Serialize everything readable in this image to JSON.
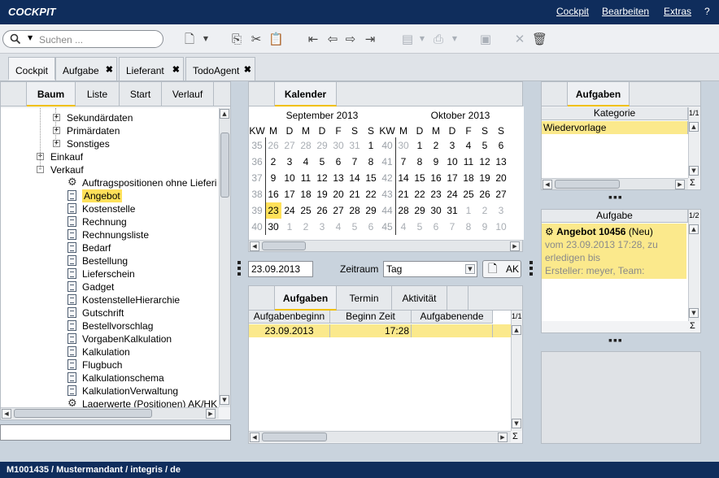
{
  "titlebar": {
    "app": "COCKPIT",
    "menu": [
      "Cockpit",
      "Bearbeiten",
      "Extras",
      "?"
    ]
  },
  "toolbar": {
    "search_placeholder": "Suchen ..."
  },
  "tabs": [
    {
      "label": "Cockpit",
      "closable": false
    },
    {
      "label": "Aufgabe",
      "closable": true
    },
    {
      "label": "Lieferant",
      "closable": true
    },
    {
      "label": "TodoAgent",
      "closable": true
    }
  ],
  "left": {
    "subtabs": [
      "Baum",
      "Liste",
      "Start",
      "Verlauf"
    ],
    "tree": [
      {
        "level": 2,
        "toggle": "+",
        "icon": "",
        "label": "Sekundärdaten"
      },
      {
        "level": 2,
        "toggle": "+",
        "icon": "",
        "label": "Primärdaten"
      },
      {
        "level": 2,
        "toggle": "+",
        "icon": "",
        "label": "Sonstiges"
      },
      {
        "level": 1,
        "toggle": "+",
        "icon": "",
        "label": "Einkauf"
      },
      {
        "level": 1,
        "toggle": "-",
        "icon": "",
        "label": "Verkauf"
      },
      {
        "level": 3,
        "toggle": "",
        "icon": "gear",
        "label": "Auftragspositionen ohne Lieferi"
      },
      {
        "level": 3,
        "toggle": "",
        "icon": "doc",
        "label": "Angebot",
        "selected": true
      },
      {
        "level": 3,
        "toggle": "",
        "icon": "doc",
        "label": "Kostenstelle"
      },
      {
        "level": 3,
        "toggle": "",
        "icon": "doc",
        "label": "Rechnung"
      },
      {
        "level": 3,
        "toggle": "",
        "icon": "doc",
        "label": "Rechnungsliste"
      },
      {
        "level": 3,
        "toggle": "",
        "icon": "doc",
        "label": "Bedarf"
      },
      {
        "level": 3,
        "toggle": "",
        "icon": "doc",
        "label": "Bestellung"
      },
      {
        "level": 3,
        "toggle": "",
        "icon": "doc",
        "label": "Lieferschein"
      },
      {
        "level": 3,
        "toggle": "",
        "icon": "doc",
        "label": "Gadget"
      },
      {
        "level": 3,
        "toggle": "",
        "icon": "doc",
        "label": "KostenstelleHierarchie"
      },
      {
        "level": 3,
        "toggle": "",
        "icon": "doc",
        "label": "Gutschrift"
      },
      {
        "level": 3,
        "toggle": "",
        "icon": "doc",
        "label": "Bestellvorschlag"
      },
      {
        "level": 3,
        "toggle": "",
        "icon": "doc",
        "label": "VorgabenKalkulation"
      },
      {
        "level": 3,
        "toggle": "",
        "icon": "doc",
        "label": "Kalkulation"
      },
      {
        "level": 3,
        "toggle": "",
        "icon": "doc",
        "label": "Flugbuch"
      },
      {
        "level": 3,
        "toggle": "",
        "icon": "doc",
        "label": "Kalkulationschema"
      },
      {
        "level": 3,
        "toggle": "",
        "icon": "doc",
        "label": "KalkulationVerwaltung"
      },
      {
        "level": 3,
        "toggle": "",
        "icon": "gear",
        "label": "Lagerwerte (Positionen) AK/HK"
      }
    ]
  },
  "calendar": {
    "tab": "Kalender",
    "months": [
      "September 2013",
      "Oktober 2013"
    ],
    "headers": [
      "KW",
      "M",
      "D",
      "M",
      "D",
      "F",
      "S",
      "S"
    ],
    "sep": [
      [
        "35",
        "26",
        "27",
        "28",
        "29",
        "30",
        "31",
        "1"
      ],
      [
        "36",
        "2",
        "3",
        "4",
        "5",
        "6",
        "7",
        "8"
      ],
      [
        "37",
        "9",
        "10",
        "11",
        "12",
        "13",
        "14",
        "15"
      ],
      [
        "38",
        "16",
        "17",
        "18",
        "19",
        "20",
        "21",
        "22"
      ],
      [
        "39",
        "23",
        "24",
        "25",
        "26",
        "27",
        "28",
        "29"
      ],
      [
        "40",
        "30",
        "1",
        "2",
        "3",
        "4",
        "5",
        "6"
      ]
    ],
    "oct": [
      [
        "40",
        "30",
        "1",
        "2",
        "3",
        "4",
        "5",
        "6"
      ],
      [
        "41",
        "7",
        "8",
        "9",
        "10",
        "11",
        "12",
        "13"
      ],
      [
        "42",
        "14",
        "15",
        "16",
        "17",
        "18",
        "19",
        "20"
      ],
      [
        "43",
        "21",
        "22",
        "23",
        "24",
        "25",
        "26",
        "27"
      ],
      [
        "44",
        "28",
        "29",
        "30",
        "31",
        "1",
        "2",
        "3"
      ],
      [
        "45",
        "4",
        "5",
        "6",
        "7",
        "8",
        "9",
        "10"
      ]
    ],
    "date_value": "23.09.2013",
    "zeitraum_label": "Zeitraum",
    "zeitraum_value": "Tag",
    "ak_label": "AK"
  },
  "tasks_center": {
    "subtabs": [
      "Aufgaben",
      "Termin",
      "Aktivität"
    ],
    "columns": [
      "Aufgabenbeginn",
      "Beginn Zeit",
      "Aufgabenende"
    ],
    "rows": [
      {
        "beginn": "23.09.2013",
        "zeit": "17:28",
        "ende": ""
      }
    ],
    "page": "1/1"
  },
  "right_top": {
    "tab": "Aufgaben",
    "column": "Kategorie",
    "rows": [
      "Wiedervorlage"
    ],
    "page": "1/1"
  },
  "right_mid": {
    "column": "Aufgabe",
    "page": "1/2",
    "card_title": "Angebot 10456",
    "card_status": "(Neu)",
    "card_line1": "vom 23.09.2013 17:28, zu",
    "card_line2": "erledigen bis",
    "card_line3": "Ersteller: meyer, Team:"
  },
  "sigma": "Σ",
  "status": "M1001435 / Mustermandant / integris / de"
}
